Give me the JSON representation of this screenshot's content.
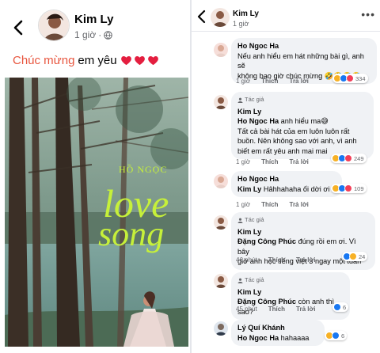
{
  "post": {
    "author": "Kim Ly",
    "time": "1 giờ",
    "dot": "·",
    "caption_highlight": "Chúc mừng",
    "caption_rest": "em yêu",
    "heart_color": "#e41e3f",
    "photo_text_top": "HỒ NGỌC",
    "photo_text_love": "love",
    "photo_text_song": "song",
    "photo_text_color": "#c6f03a"
  },
  "thread": {
    "author": "Kim Ly",
    "time": "1 giờ",
    "dots": "•••"
  },
  "comments": [
    {
      "name": "Ho Ngoc Ha",
      "lines": [
        "Nếu anh hiểu em hát những bài gì, anh sẽ",
        "không bao giờ chúc mừng 🤣🤣🤣🤣"
      ],
      "time": "1 giờ",
      "like": "Thích",
      "reply": "Trả lời",
      "count": "334"
    },
    {
      "tag": "Tác giả",
      "name": "Kim Ly",
      "mention": "Ho Ngoc Ha",
      "first": "anh hiểu ma😅",
      "lines": [
        "Tất cả bài hát của em luôn luôn rất",
        "buồn. Nên không sao với anh, vì anh",
        "biết em rất yêu anh mai mai"
      ],
      "time": "1 giờ",
      "like": "Thích",
      "reply": "Trả lời",
      "count": "249"
    },
    {
      "name": "Ho Ngoc Ha",
      "mention": "Kim Ly",
      "first": "Hâhhahaha ối dời ơi",
      "time": "1 giờ",
      "like": "Thích",
      "reply": "Trả lời",
      "count": "109"
    },
    {
      "tag": "Tác giả",
      "name": "Kim Ly",
      "mention": "Đặng Công Phúc",
      "first": "đúng rồi em ơi. Vì bây",
      "lines": [
        "giờ anh học tiếng việt 3 ngay một tuần"
      ],
      "time": "46 phút",
      "like": "Thích",
      "reply": "Trả lời",
      "count": "24"
    },
    {
      "tag": "Tác giả",
      "name": "Kim Ly",
      "mention": "Đặng Công Phúc",
      "first": "còn anh thì sao?",
      "time": "45 phút",
      "like": "Thích",
      "reply": "Trả lời",
      "count": "6"
    },
    {
      "name": "Lý Quí Khánh",
      "mention": "Ho Ngoc Ha",
      "first": "hahaaaa",
      "count": "6"
    }
  ],
  "colors": {
    "like_blue": "#1877f2",
    "love_red": "#f33e58",
    "haha_yellow": "#f7b125",
    "bubble_bg": "#f0f2f5"
  }
}
